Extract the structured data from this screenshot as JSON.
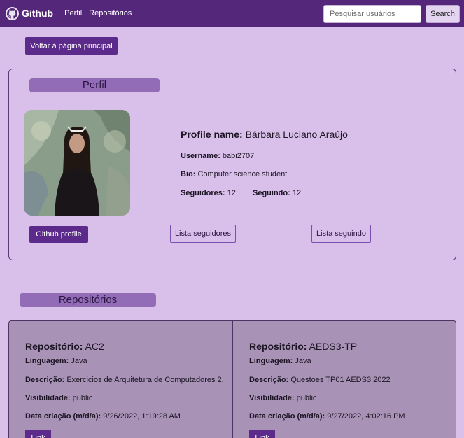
{
  "navbar": {
    "brand": "Github",
    "links": [
      "Perfil",
      "Repositórios"
    ],
    "search_placeholder": "Pesquisar usuários",
    "search_button": "Search"
  },
  "back_button": "Voltar à página principal",
  "profile": {
    "section_title": "Perfil",
    "name_label": "Profile name:",
    "name": "Bárbara Luciano Araújo",
    "username_label": "Username:",
    "username": "babi2707",
    "bio_label": "Bio:",
    "bio": "Computer science student.",
    "followers_label": "Seguidores:",
    "followers": "12",
    "following_label": "Seguindo:",
    "following": "12",
    "github_profile_button": "Github profile",
    "list_followers_button": "Lista seguidores",
    "list_following_button": "Lista seguindo"
  },
  "repos": {
    "section_title": "Repositórios",
    "labels": {
      "repo": "Repositório:",
      "language": "Linguagem:",
      "description": "Descrição:",
      "visibility": "Visibilidade:",
      "created": "Data criação (m/d/a):"
    },
    "link_button": "Link",
    "items": [
      {
        "name": "AC2",
        "language": "Java",
        "description": "Exercicios de Arquitetura de Computadores 2.",
        "visibility": "public",
        "created": "9/26/2022, 1:19:28 AM"
      },
      {
        "name": "AEDS3-TP",
        "language": "Java",
        "description": "Questoes TP01 AEDS3 2022",
        "visibility": "public",
        "created": "9/27/2022, 4:02:16 PM"
      }
    ]
  },
  "colors": {
    "navbar": "#55277a",
    "background": "#d9c0ea",
    "primary_button": "#5b2a8a",
    "section_title": "#936cb8",
    "repo_card": "#a893b6"
  }
}
